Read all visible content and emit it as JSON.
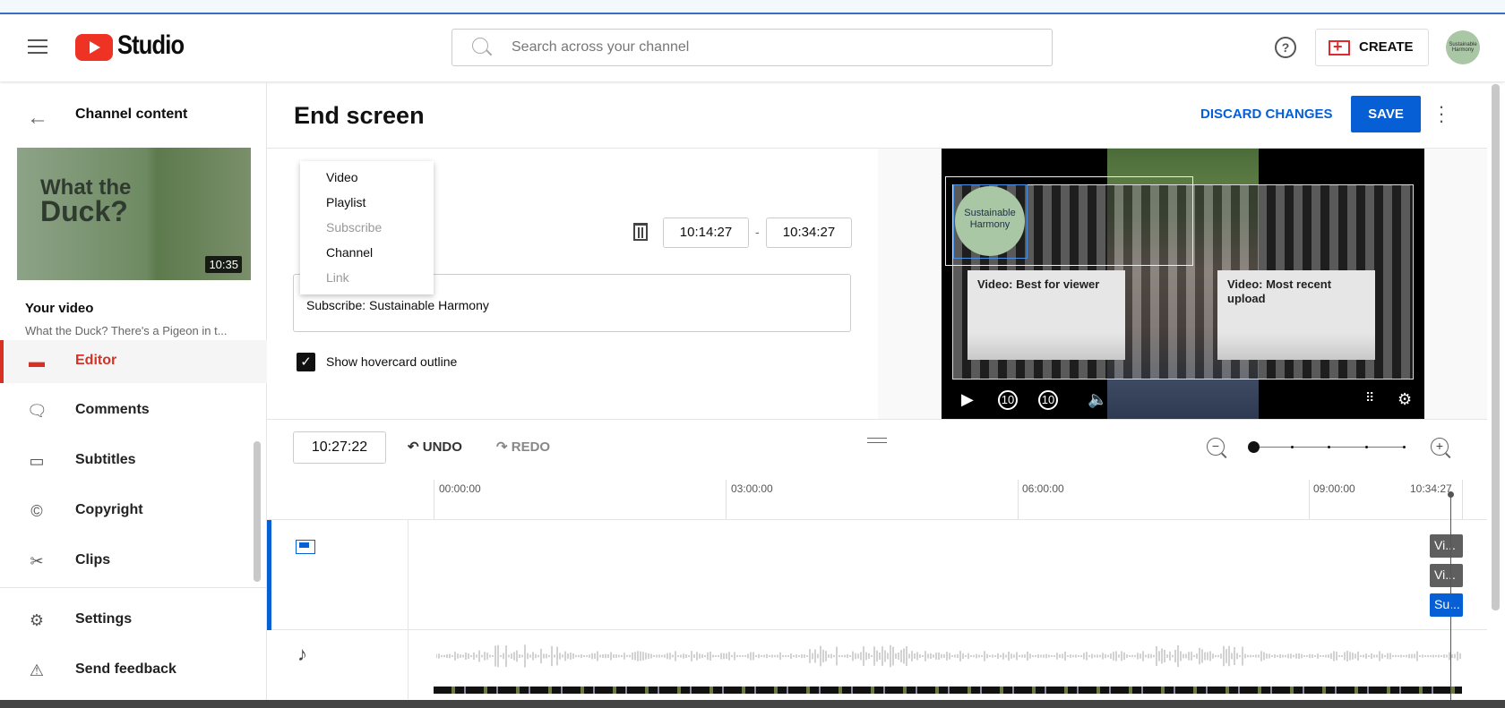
{
  "header": {
    "app_name": "Studio",
    "search_placeholder": "Search across your channel",
    "help": "?",
    "create_label": "CREATE",
    "avatar_text": "Sustainable Harmony"
  },
  "sidebar": {
    "back_label": "Channel content",
    "video": {
      "thumb_title_1": "What the",
      "thumb_title_2": "Duck?",
      "duration": "10:35",
      "heading": "Your video",
      "title": "What the Duck? There's a Pigeon in t..."
    },
    "items": [
      {
        "label": "Editor",
        "icon": "editor-icon",
        "active": true
      },
      {
        "label": "Comments",
        "icon": "comment-icon"
      },
      {
        "label": "Subtitles",
        "icon": "subtitles-icon"
      },
      {
        "label": "Copyright",
        "icon": "copyright-icon"
      },
      {
        "label": "Clips",
        "icon": "scissors-icon"
      }
    ],
    "bottom": [
      {
        "label": "Settings",
        "icon": "gear-icon"
      },
      {
        "label": "Send feedback",
        "icon": "feedback-icon"
      }
    ]
  },
  "main": {
    "title": "End screen",
    "discard_label": "DISCARD CHANGES",
    "save_label": "SAVE",
    "menu": [
      {
        "label": "Video",
        "disabled": false
      },
      {
        "label": "Playlist",
        "disabled": false
      },
      {
        "label": "Subscribe",
        "disabled": true
      },
      {
        "label": "Channel",
        "disabled": false
      },
      {
        "label": "Link",
        "disabled": true
      }
    ],
    "start_time": "10:14:27",
    "end_time": "10:34:27",
    "dash": "-",
    "element_text": "Subscribe: Sustainable Harmony",
    "checkbox_label": "Show hovercard outline",
    "checkbox_checked": true
  },
  "player": {
    "channel_logo_text": "Sustainable Harmony",
    "card1": "Video: Best for viewer",
    "card2": "Video: Most recent upload",
    "rewind": "10",
    "forward": "10"
  },
  "timeline": {
    "current_time": "10:27:22",
    "undo_label": "UNDO",
    "redo_label": "REDO",
    "zoom_level": 0,
    "ticks": [
      "00:00:00",
      "03:00:00",
      "06:00:00",
      "09:00:00",
      "10:34:27"
    ],
    "chips": [
      {
        "label": "Vi...",
        "type": "video"
      },
      {
        "label": "Vi...",
        "type": "video"
      },
      {
        "label": "Su...",
        "type": "subscribe"
      }
    ]
  },
  "colors": {
    "accent": "#065fd4",
    "brand": "#ee3324",
    "active": "#d93025"
  }
}
